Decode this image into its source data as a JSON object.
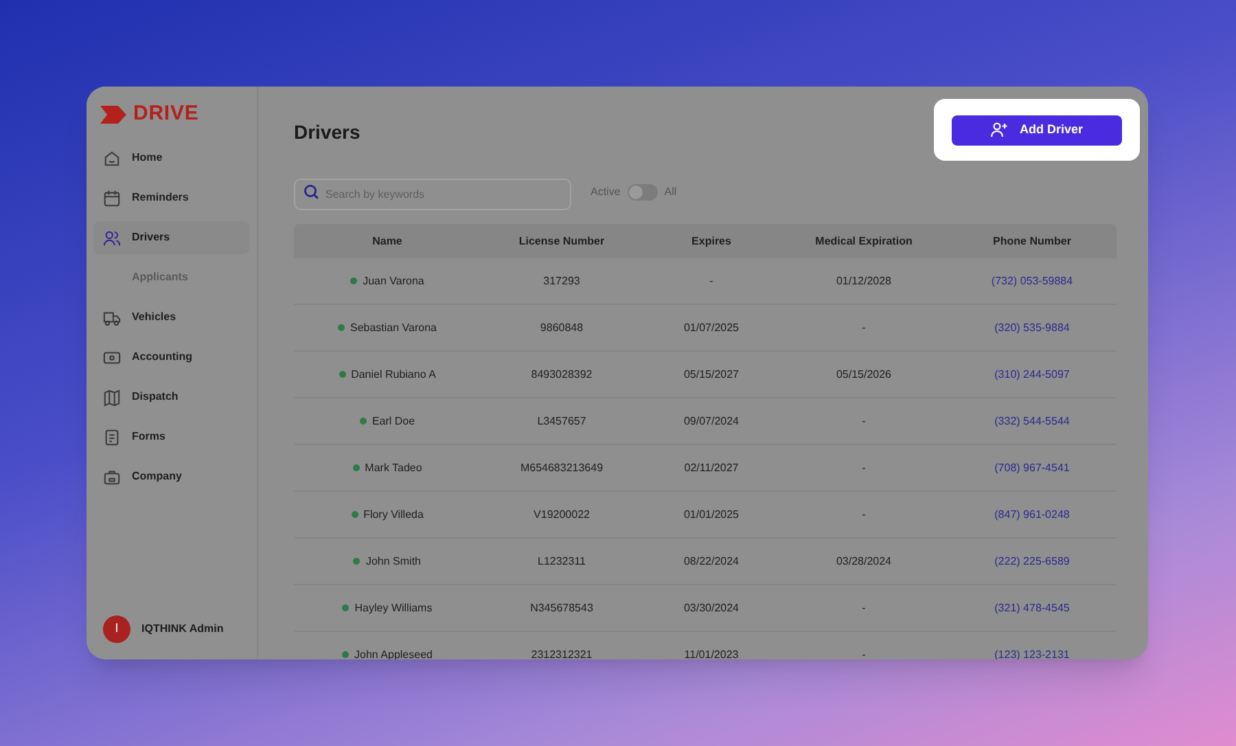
{
  "logo": "DRIVE",
  "sidebar": {
    "items": [
      {
        "label": "Home",
        "kind": "home",
        "selected": false
      },
      {
        "label": "Reminders",
        "kind": "calendar",
        "selected": false
      },
      {
        "label": "Drivers",
        "kind": "users",
        "selected": true
      },
      {
        "label": "Applicants",
        "kind": "sub",
        "selected": false
      },
      {
        "label": "Vehicles",
        "kind": "truck",
        "selected": false
      },
      {
        "label": "Accounting",
        "kind": "money",
        "selected": false
      },
      {
        "label": "Dispatch",
        "kind": "map",
        "selected": false
      },
      {
        "label": "Forms",
        "kind": "form",
        "selected": false
      },
      {
        "label": "Company",
        "kind": "briefcase",
        "selected": false
      }
    ],
    "user": {
      "initial": "I",
      "name": "IQTHINK Admin"
    }
  },
  "page": {
    "title": "Drivers",
    "add_button": "Add Driver"
  },
  "search": {
    "placeholder": "Search by keywords"
  },
  "filter": {
    "left": "Active",
    "right": "All",
    "on": false
  },
  "table": {
    "columns": [
      "Name",
      "License Number",
      "Expires",
      "Medical Expiration",
      "Phone Number"
    ],
    "rows": [
      {
        "active": true,
        "cells": [
          "Juan Varona",
          "317293",
          "-",
          "01/12/2028",
          "(732) 053-59884"
        ]
      },
      {
        "active": true,
        "cells": [
          "Sebastian Varona",
          "9860848",
          "01/07/2025",
          "-",
          "(320) 535-9884"
        ]
      },
      {
        "active": true,
        "cells": [
          "Daniel Rubiano A",
          "8493028392",
          "05/15/2027",
          "05/15/2026",
          "(310) 244-5097"
        ]
      },
      {
        "active": true,
        "cells": [
          "Earl Doe",
          "L3457657",
          "09/07/2024",
          "-",
          "(332) 544-5544"
        ]
      },
      {
        "active": true,
        "cells": [
          "Mark Tadeo",
          "M654683213649",
          "02/11/2027",
          "-",
          "(708) 967-4541"
        ]
      },
      {
        "active": true,
        "cells": [
          "Flory Villeda",
          "V19200022",
          "01/01/2025",
          "-",
          "(847) 961-0248"
        ]
      },
      {
        "active": true,
        "cells": [
          "John Smith",
          "L1232311",
          "08/22/2024",
          "03/28/2024",
          "(222) 225-6589"
        ]
      },
      {
        "active": true,
        "cells": [
          "Hayley Williams",
          "N345678543",
          "03/30/2024",
          "-",
          "(321) 478-4545"
        ]
      },
      {
        "active": true,
        "cells": [
          "John Appleseed",
          "2312312321",
          "11/01/2023",
          "-",
          "(123) 123-2131"
        ]
      }
    ]
  }
}
